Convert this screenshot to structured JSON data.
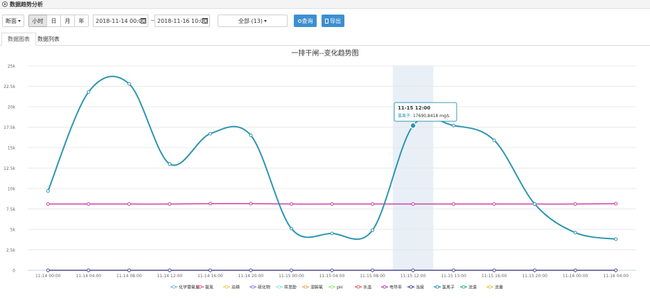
{
  "header": {
    "title": "数据趋势分析",
    "icon": "circle-arrow-icon"
  },
  "toolbar": {
    "section_dropdown": "断面",
    "granularity": [
      "小时",
      "日",
      "月",
      "年"
    ],
    "granularity_active": "小时",
    "start_time": "2018-11-14 00:00",
    "end_time": "2018-11-16 10:00",
    "range_separator": "~",
    "filter_select": "全部 (13)",
    "query_label": "查询",
    "export_label": "导出",
    "accent_color": "#3d8fd1"
  },
  "tabs": [
    "数据图表",
    "数据列表"
  ],
  "tab_active": "数据图表",
  "tooltip": {
    "time": "11-15 12:00",
    "series": "氯离子",
    "value": "17690.8418 mg/L"
  },
  "chart_data": {
    "type": "line",
    "title": "一排干闸--变化趋势图",
    "categories": [
      "11-14 00:00",
      "11-14 04:00",
      "11-14 08:00",
      "11-14 12:00",
      "11-14 16:00",
      "11-14 20:00",
      "11-15 00:00",
      "11-15 04:00",
      "11-15 08:00",
      "11-15 12:00",
      "11-15 13:00",
      "11-15 16:00",
      "11-15 20:00",
      "11-16 00:00",
      "11-16 04:00"
    ],
    "ylim": [
      0,
      25000
    ],
    "yticks": [
      "0",
      "2.5k",
      "5k",
      "7.5k",
      "10k",
      "12.5k",
      "15k",
      "17.5k",
      "20k",
      "22.5k",
      "25k"
    ],
    "highlight_category": "11-15 12:00",
    "grid": true,
    "legend_position": "bottom",
    "series": [
      {
        "name": "化学需氧量",
        "color": "#7cb5ec",
        "values": []
      },
      {
        "name": "氨氮",
        "color": "#f15c80",
        "values": []
      },
      {
        "name": "总磷",
        "color": "#e4d354",
        "values": []
      },
      {
        "name": "硫化物",
        "color": "#8085e8",
        "values": []
      },
      {
        "name": "挥发酚",
        "color": "#91e8e1",
        "values": []
      },
      {
        "name": "溶解氧",
        "color": "#f7a35c",
        "values": []
      },
      {
        "name": "pH",
        "color": "#90ed7d",
        "values": []
      },
      {
        "name": "水温",
        "color": "#f45b5b",
        "values": []
      },
      {
        "name": "电导率",
        "color": "#cc3fa4",
        "values": [
          8100,
          8100,
          8100,
          8100,
          8150,
          8150,
          8100,
          8100,
          8100,
          8100,
          8100,
          8100,
          8100,
          8100,
          8150
        ]
      },
      {
        "name": "浊度",
        "color": "#4a4a8c",
        "values": [
          0,
          0,
          0,
          0,
          0,
          0,
          0,
          0,
          0,
          0,
          0,
          0,
          0,
          0,
          0
        ]
      },
      {
        "name": "氯离子",
        "color": "#2b94b0",
        "values": [
          9700,
          21800,
          22800,
          13000,
          16700,
          16500,
          5100,
          4500,
          4900,
          17690.8418,
          17700,
          15900,
          8100,
          4600,
          3800
        ]
      },
      {
        "name": "流速",
        "color": "#2bb597",
        "values": []
      },
      {
        "name": "流量",
        "color": "#e5c24a",
        "values": []
      }
    ]
  }
}
